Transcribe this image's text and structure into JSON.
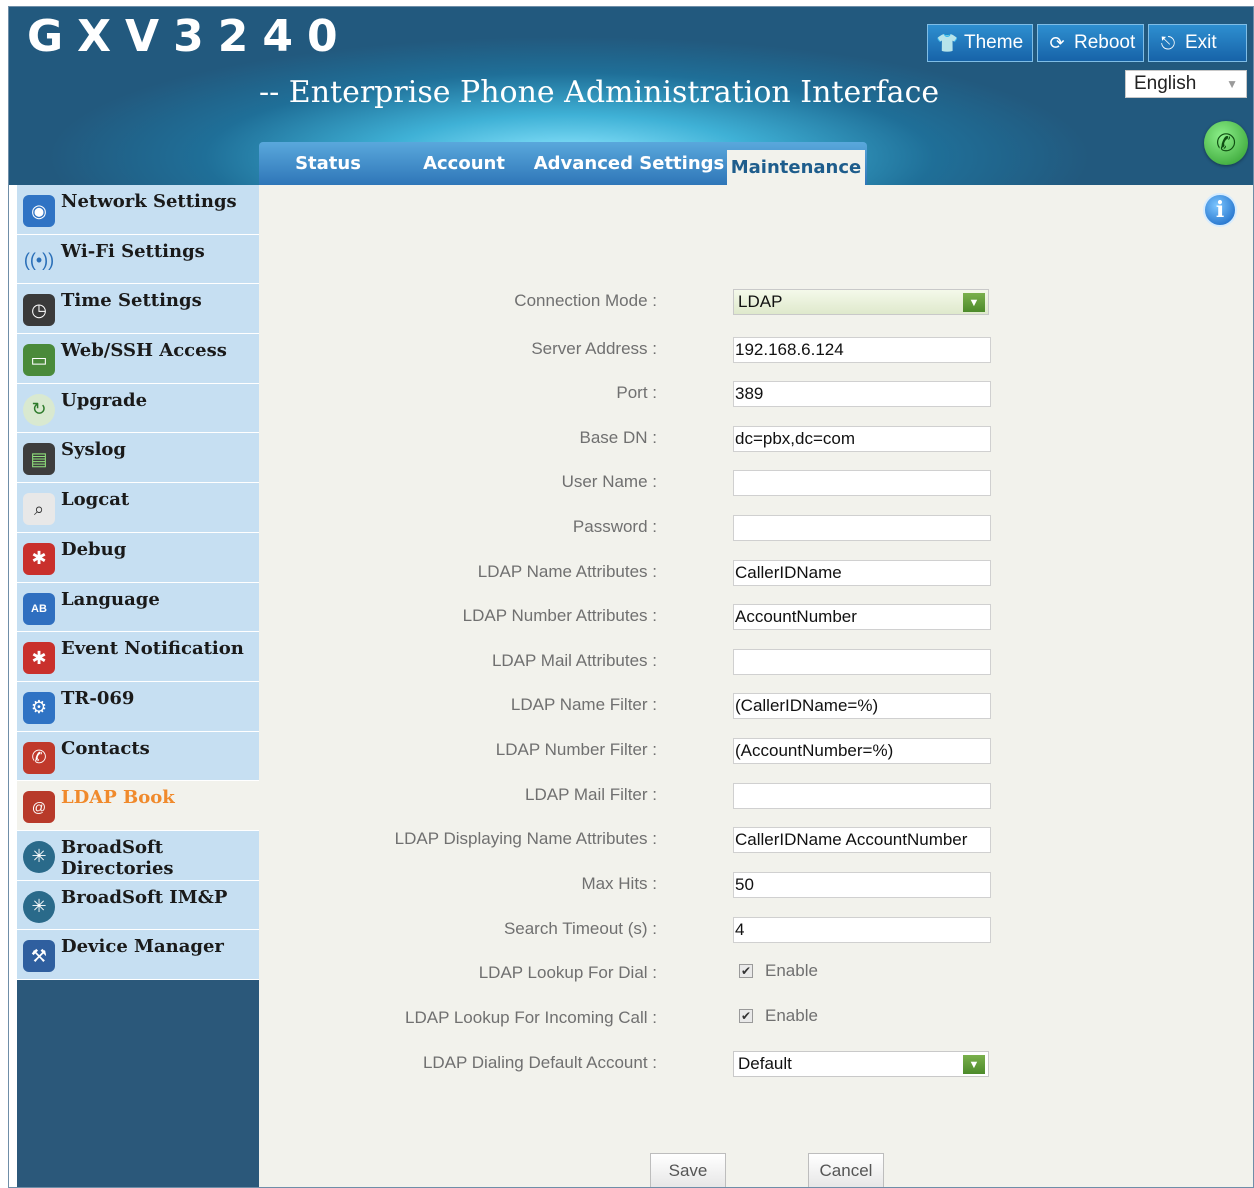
{
  "header": {
    "logo": "GXV3240",
    "subtitle": "-- Enterprise Phone Administration Interface",
    "buttons": [
      {
        "label": "Theme",
        "icon": "shirt-icon"
      },
      {
        "label": "Reboot",
        "icon": "reboot-icon"
      },
      {
        "label": "Exit",
        "icon": "exit-icon"
      }
    ],
    "language": "English"
  },
  "tabs": [
    "Status",
    "Account",
    "Advanced Settings",
    "Maintenance"
  ],
  "active_tab": "Maintenance",
  "sidebar": {
    "items": [
      {
        "label": "Network Settings",
        "icon": "network-icon"
      },
      {
        "label": "Wi-Fi Settings",
        "icon": "wifi-icon"
      },
      {
        "label": "Time Settings",
        "icon": "clock-icon"
      },
      {
        "label": "Web/SSH Access",
        "icon": "computer-icon"
      },
      {
        "label": "Upgrade",
        "icon": "upgrade-icon"
      },
      {
        "label": "Syslog",
        "icon": "syslog-icon"
      },
      {
        "label": "Logcat",
        "icon": "magnifier-icon"
      },
      {
        "label": "Debug",
        "icon": "bug-icon"
      },
      {
        "label": "Language",
        "icon": "language-icon"
      },
      {
        "label": "Event Notification",
        "icon": "bug-icon"
      },
      {
        "label": "TR-069",
        "icon": "tr069-icon"
      },
      {
        "label": "Contacts",
        "icon": "phone-book-icon"
      },
      {
        "label": "LDAP Book",
        "icon": "ldap-book-icon"
      },
      {
        "label": "BroadSoft Directories",
        "icon": "broadsoft-icon"
      },
      {
        "label": "BroadSoft IM&P",
        "icon": "broadsoft-icon"
      },
      {
        "label": "Device Manager",
        "icon": "device-manager-icon"
      }
    ],
    "active": "LDAP Book"
  },
  "form": {
    "connection_mode": {
      "label": "Connection Mode :",
      "value": "LDAP"
    },
    "server_address": {
      "label": "Server Address :",
      "value": "192.168.6.124"
    },
    "port": {
      "label": "Port :",
      "value": "389"
    },
    "base_dn": {
      "label": "Base DN :",
      "value": "dc=pbx,dc=com"
    },
    "user_name": {
      "label": "User Name :",
      "value": ""
    },
    "password": {
      "label": "Password :",
      "value": ""
    },
    "ldap_name_attributes": {
      "label": "LDAP Name Attributes :",
      "value": "CallerIDName"
    },
    "ldap_number_attributes": {
      "label": "LDAP Number Attributes :",
      "value": "AccountNumber"
    },
    "ldap_mail_attributes": {
      "label": "LDAP Mail Attributes :",
      "value": ""
    },
    "ldap_name_filter": {
      "label": "LDAP Name Filter :",
      "value": "(CallerIDName=%)"
    },
    "ldap_number_filter": {
      "label": "LDAP Number Filter :",
      "value": "(AccountNumber=%)"
    },
    "ldap_mail_filter": {
      "label": "LDAP Mail Filter :",
      "value": ""
    },
    "ldap_displaying_name_attributes": {
      "label": "LDAP Displaying Name Attributes :",
      "value": "CallerIDName AccountNumber"
    },
    "max_hits": {
      "label": "Max Hits :",
      "value": "50"
    },
    "search_timeout": {
      "label": "Search Timeout (s) :",
      "value": "4"
    },
    "lookup_for_dial": {
      "label": "LDAP Lookup For Dial :",
      "checkbox_label": "Enable",
      "checked": true
    },
    "lookup_for_incoming": {
      "label": "LDAP Lookup For Incoming Call :",
      "checkbox_label": "Enable",
      "checked": true
    },
    "dialing_default_account": {
      "label": "LDAP Dialing Default Account :",
      "value": "Default"
    }
  },
  "actions": {
    "save": "Save",
    "cancel": "Cancel"
  },
  "colors": {
    "active_nav_text": "#f08a2c",
    "nav_bg": "#c6dff2",
    "content_bg": "#f2f2ec",
    "sidebar_bg": "#2b587a"
  }
}
